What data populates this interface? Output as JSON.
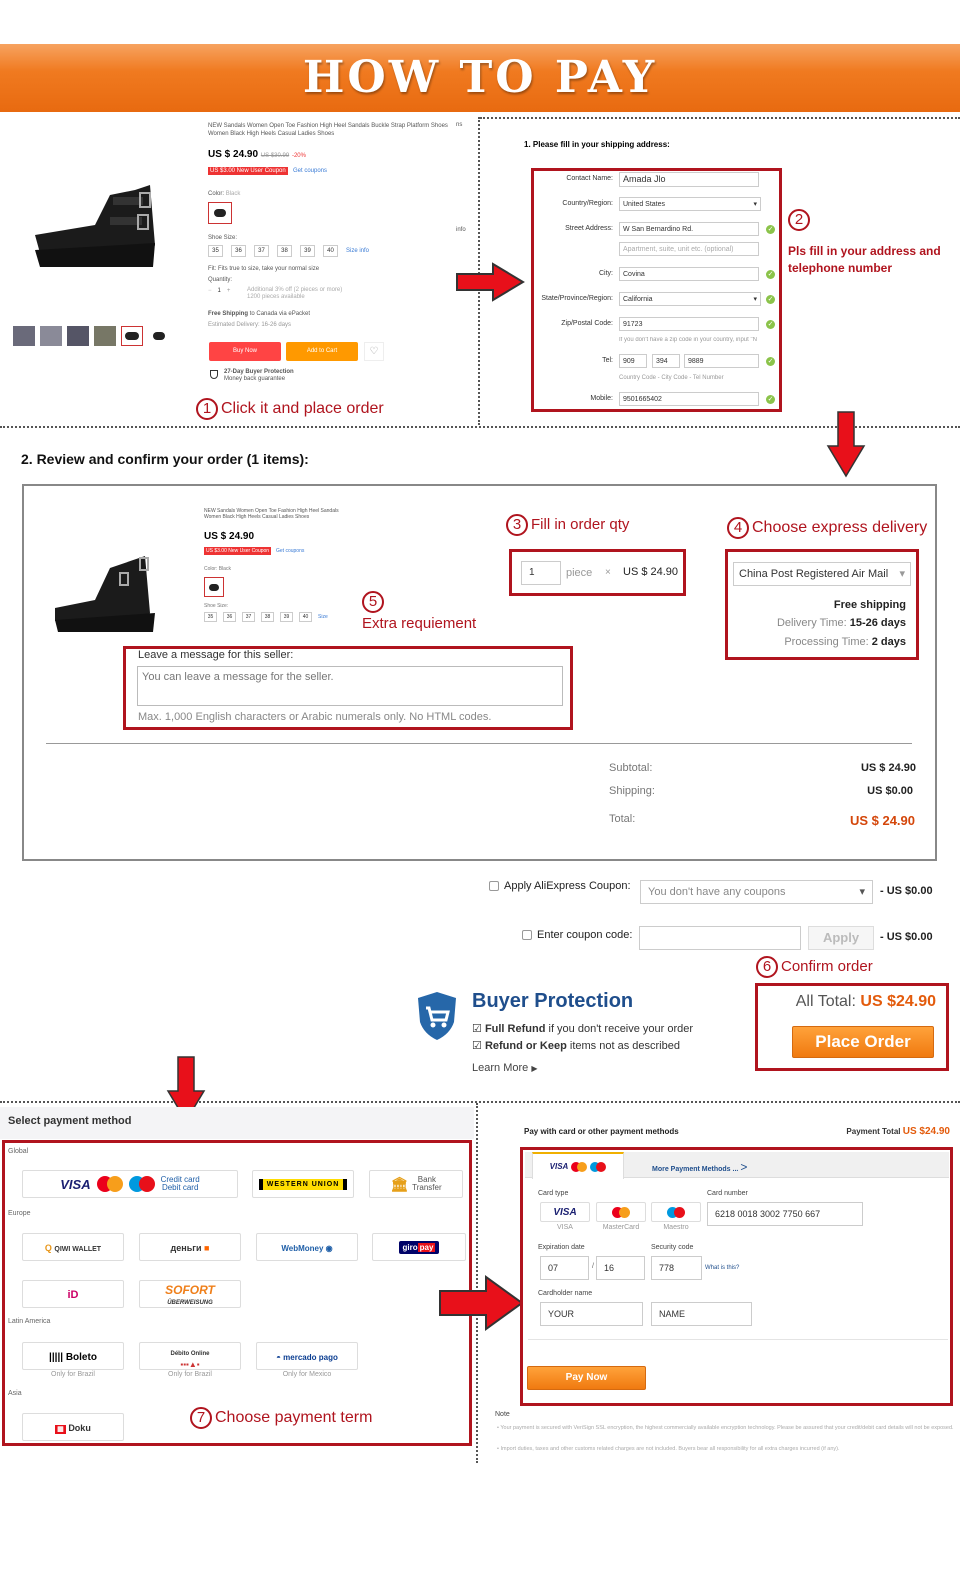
{
  "banner": {
    "title": "HOW TO PAY"
  },
  "product": {
    "title": "NEW Sandals Women Open Toe Fashion High Heel Sandals Buckle Strap Platform Shoes Women Black High Heels Casual Ladies Shoes",
    "price_prefix": "US $",
    "price": "24.90",
    "old_price": "US $30.99",
    "discount": "-20%",
    "coupon": "US $3.00 New User Coupon",
    "get_coupons": "Get coupons",
    "color_label": "Color:",
    "color_value": "Black",
    "size_label": "Shoe Size:",
    "sizes": [
      "35",
      "36",
      "37",
      "38",
      "39",
      "40"
    ],
    "size_info": "Size info",
    "fit": "Fit: Fits true to size, take your normal size",
    "quantity_label": "Quantity:",
    "quantity": "1",
    "quantity_note": "Additional 3% off (2 pieces or more)",
    "available": "1200 pieces available",
    "shipping_bold": "Free Shipping",
    "shipping_rest": "to Canada via ePacket",
    "delivery": "Estimated Delivery: 16-26 days",
    "buy_now": "Buy Now",
    "add_to_cart": "Add to Cart",
    "protection_title": "27-Day Buyer Protection",
    "protection_sub": "Money back guarantee",
    "side_label_1": "ns",
    "side_label_2": "info"
  },
  "step1": {
    "num": "1",
    "text": "Click it and place order"
  },
  "shipping": {
    "heading": "1. Please fill in your shipping address:",
    "fields": [
      {
        "label": "Contact Name:",
        "value": "Amada  Jlo"
      },
      {
        "label": "Country/Region:",
        "value": "United States"
      },
      {
        "label": "Street Address:",
        "value": "W San Bernardino Rd."
      },
      {
        "label": "",
        "placeholder": "Apartment, suite, unit etc. (optional)"
      },
      {
        "label": "City:",
        "value": "Covina"
      },
      {
        "label": "State/Province/Region:",
        "value": "California"
      },
      {
        "label": "Zip/Postal Code:",
        "value": "91723"
      },
      {
        "label": "Mobile:",
        "value": "9501665402"
      }
    ],
    "zip_note": "If you don't have a zip code in your country, input \"N",
    "tel_label": "Tel:",
    "tel": [
      "909",
      "394",
      "9889"
    ],
    "tel_note": "Country Code - City Code - Tel Number"
  },
  "step2": {
    "num": "2",
    "text": "Pls fill in your address and telephone number"
  },
  "review": {
    "heading": "2. Review and confirm your order (1 items):",
    "product_title": "NEW Sandals Women Open Toe Fashion High Heel Sandals Women Black High Heels Casual Ladies Shoes",
    "price": "US $ 24.90",
    "coupon": "US $3.00 New User Coupon",
    "get_coupons": "Get coupons",
    "color_label": "Color: Black",
    "size_label": "Shoe Size:",
    "sizes": [
      "35",
      "36",
      "37",
      "38",
      "39",
      "40"
    ],
    "size_info": "Size",
    "qty": "1",
    "piece": "piece",
    "times": "×",
    "unit_price": "US $ 24.90",
    "delivery_method": "China Post Registered Air Mail",
    "free_shipping": "Free shipping",
    "delivery_time_label": "Delivery Time:",
    "delivery_time": "15-26 days",
    "processing_label": "Processing Time:",
    "processing_time": "2 days",
    "message_label": "Leave a message for this seller:",
    "message_placeholder": "You can leave a message for the seller.",
    "message_note": "Max. 1,000 English characters or Arabic numerals only. No HTML codes.",
    "subtotal_label": "Subtotal:",
    "subtotal": "US $ 24.90",
    "shipping_label": "Shipping:",
    "shipping": "US $0.00",
    "total_label": "Total:",
    "total": "US $ 24.90"
  },
  "step3": {
    "num": "3",
    "text": "Fill in order qty"
  },
  "step4": {
    "num": "4",
    "text": "Choose express delivery"
  },
  "step5": {
    "num": "5",
    "text": "Extra requiement"
  },
  "coupons": {
    "ali_label": "Apply AliExpress Coupon:",
    "ali_select": "You don't have any coupons",
    "ali_amount": "- US $0.00",
    "code_label": "Enter coupon code:",
    "code_value": "",
    "apply": "Apply",
    "code_amount": "- US $0.00"
  },
  "step6": {
    "num": "6",
    "text": "Confirm order"
  },
  "buyer_protection": {
    "title": "Buyer Protection",
    "line1_bold": "Full Refund",
    "line1_rest": " if you don't receive your order",
    "line2_bold": "Refund or Keep",
    "line2_rest": " items not as described",
    "learn_more": "Learn More"
  },
  "confirm": {
    "all_total_label": "All Total:",
    "all_total": "US $24.90",
    "place_order": "Place Order"
  },
  "payment_methods": {
    "heading": "Select payment method",
    "groups": [
      {
        "name": "Global",
        "items": [
          {
            "label": "VISA / MasterCard / Maestro — Credit card Debit card"
          },
          {
            "label": "WESTERN UNION"
          },
          {
            "label": "Bank Transfer"
          }
        ]
      },
      {
        "name": "Europe",
        "items": [
          {
            "label": "QIWI WALLET"
          },
          {
            "label": "Яндекс Деньги"
          },
          {
            "label": "WebMoney"
          },
          {
            "label": "giropay"
          },
          {
            "label": "iDEAL"
          },
          {
            "label": "SOFORT ÜBERWEISUNG"
          }
        ]
      },
      {
        "name": "Latin America",
        "items": [
          {
            "label": "Boleto",
            "note": "Only for Brazil"
          },
          {
            "label": "Débito Online",
            "note": "Only for Brazil"
          },
          {
            "label": "mercado pago",
            "note": "Only for Mexico"
          }
        ]
      },
      {
        "name": "Asia",
        "items": [
          {
            "label": "Doku"
          }
        ]
      }
    ]
  },
  "step7": {
    "num": "7",
    "text": "Choose payment term"
  },
  "card": {
    "heading": "Pay with card or other payment methods",
    "payment_total_label": "Payment Total",
    "payment_total": "US $24.90",
    "tab_more": "More Payment Methods ...",
    "card_type_label": "Card type",
    "card_types": [
      "VISA",
      "MasterCard",
      "Maestro"
    ],
    "card_number_label": "Card number",
    "card_number": "6218 0018 3002 7750 667",
    "expiry_label": "Expiration date",
    "exp_month": "07",
    "exp_year": "16",
    "security_label": "Security code",
    "security": "778",
    "what_is_this": "What is this?",
    "holder_label": "Cardholder name",
    "first_name": "YOUR",
    "last_name": "NAME",
    "pay_now": "Pay Now",
    "note_label": "Note",
    "note1": "Your payment is secured with VeriSign SSL encryption, the highest commercially available encryption technology. Please be assured that your credit/debit card details will not be exposed.",
    "note2": "Import duties, taxes and other customs related charges are not included. Buyers bear all responsibility for all extra charges incurred (if any)."
  }
}
